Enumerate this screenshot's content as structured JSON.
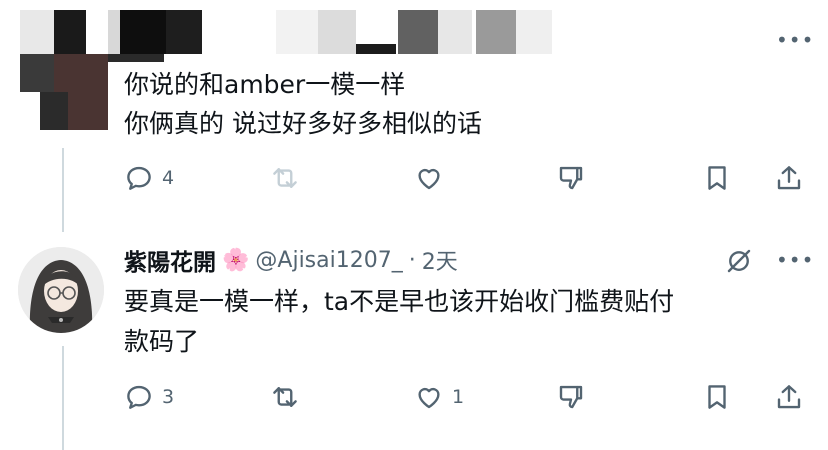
{
  "tweet1": {
    "more_label": "•••",
    "line1": "你说的和amber一模一样",
    "line2": "你俩真的 说过好多好多相似的话",
    "actions": {
      "reply_count": "4",
      "retweet_count": "",
      "like_count": "",
      "dislike_count": ""
    }
  },
  "tweet2": {
    "display_name": "紫陽花開",
    "name_emoji": "🌸",
    "handle": "@Ajisai1207_",
    "separator": "·",
    "time": "2天",
    "more_label": "•••",
    "line1": "要真是一模一样，ta不是早也该开始收门槛费贴付",
    "line2": "款码了",
    "actions": {
      "reply_count": "3",
      "retweet_count": "",
      "like_count": "1",
      "dislike_count": ""
    }
  },
  "colors": {
    "icon_gray": "#536471",
    "thread_line": "#cfd9de",
    "retweet_disabled": "#c4cfd6"
  },
  "icons": [
    "reply-icon",
    "retweet-icon",
    "like-icon",
    "dislike-icon",
    "bookmark-icon",
    "share-icon",
    "grok-icon",
    "more-icon"
  ]
}
